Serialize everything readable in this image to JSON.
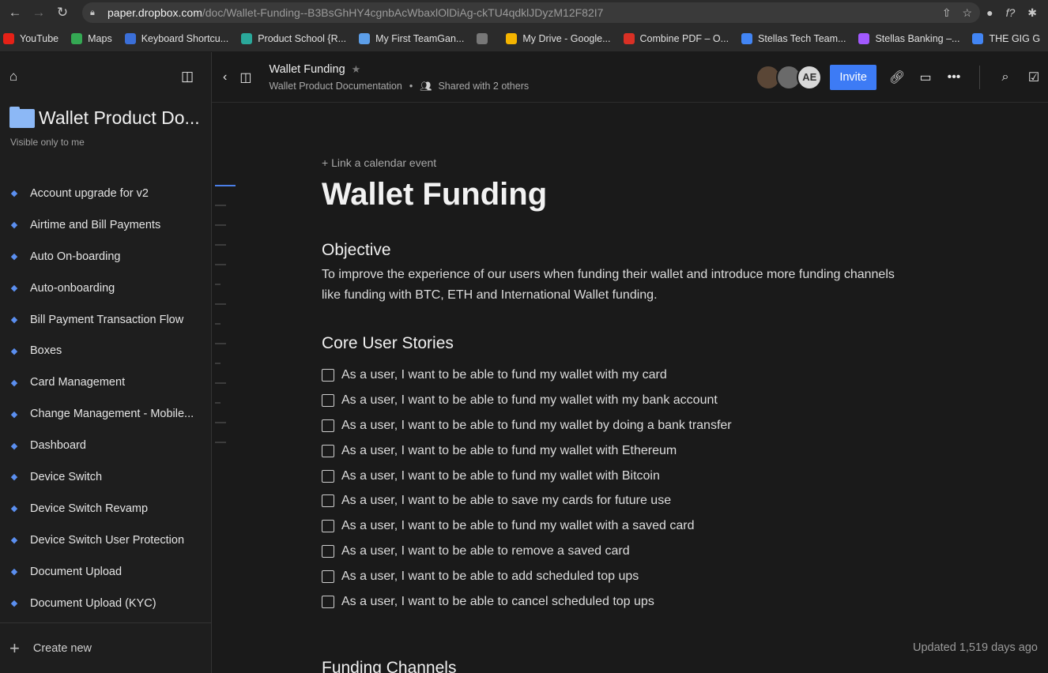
{
  "browser": {
    "url_host": "paper.dropbox.com",
    "url_path": "/doc/Wallet-Funding--B3BsGhHY4cgnbAcWbaxlOlDiAg-ckTU4qdklJDyzM12F82I7"
  },
  "bookmarks": [
    {
      "label": "YouTube",
      "icon": "youtube-icon",
      "color": "#e62117"
    },
    {
      "label": "Maps",
      "icon": "maps-icon",
      "color": "#34a853"
    },
    {
      "label": "Keyboard Shortcu...",
      "icon": "keyboard-icon",
      "color": "#3b6fd8"
    },
    {
      "label": "Product School {R...",
      "icon": "product-school-icon",
      "color": "#2aa89a"
    },
    {
      "label": "My First TeamGan...",
      "icon": "teamgantt-icon",
      "color": "#5c9ee8"
    },
    {
      "label": "",
      "icon": "globe-icon",
      "color": "#777777"
    },
    {
      "label": "My Drive - Google...",
      "icon": "drive-icon",
      "color": "#f4b400"
    },
    {
      "label": "Combine PDF – O...",
      "icon": "pdf-icon",
      "color": "#d93025"
    },
    {
      "label": "Stellas Tech Team...",
      "icon": "docs-icon",
      "color": "#4285f4"
    },
    {
      "label": "Stellas Banking –...",
      "icon": "figma-icon",
      "color": "#a259ff"
    },
    {
      "label": "THE GIG G",
      "icon": "meet-icon",
      "color": "#4285f4"
    }
  ],
  "sidebar": {
    "folder_title": "Wallet Product Do...",
    "visibility": "Visible only to me",
    "items": [
      {
        "label": "Account upgrade for v2"
      },
      {
        "label": "Airtime and Bill Payments"
      },
      {
        "label": "Auto On-boarding"
      },
      {
        "label": "Auto-onboarding"
      },
      {
        "label": "Bill Payment Transaction Flow"
      },
      {
        "label": "Boxes"
      },
      {
        "label": "Card Management"
      },
      {
        "label": "Change Management - Mobile..."
      },
      {
        "label": "Dashboard"
      },
      {
        "label": "Device Switch"
      },
      {
        "label": "Device Switch Revamp"
      },
      {
        "label": "Device Switch User Protection"
      },
      {
        "label": "Document Upload"
      },
      {
        "label": "Document Upload (KYC)"
      }
    ],
    "create_new": "Create new"
  },
  "topbar": {
    "doc_title": "Wallet Funding",
    "breadcrumb": "Wallet Product Documentation",
    "separator": "•",
    "shared": "Shared with 2 others",
    "avatar_initials": "AE",
    "invite_label": "Invite"
  },
  "doc": {
    "link_calendar": "+ Link a calendar event",
    "title": "Wallet Funding",
    "objective_heading": "Objective",
    "objective_text": "To improve the experience of our users when funding their wallet and introduce more funding channels like funding with BTC, ETH and International Wallet funding.",
    "stories_heading": "Core User Stories",
    "stories": [
      "As a user, I want to be able to fund my wallet with my card",
      "As a user, I want to be able to fund my wallet with my bank account",
      "As a user, I want to be able to fund my wallet by doing a bank transfer",
      "As a user, I want to be able to fund my wallet with Ethereum",
      "As a user, I want to be able to fund my wallet with Bitcoin",
      "As a user, I want to be able to save my cards for future use",
      "As a user, I want to be able to fund my wallet with a saved card",
      "As a user, I want to be able to remove a saved card",
      "As a user, I want to be able to add scheduled top ups",
      "As a user, I want to be able to cancel scheduled top ups"
    ],
    "channels_heading": "Funding Channels",
    "updated": "Updated 1,519 days ago"
  },
  "colors": {
    "accent": "#3d7bf5",
    "doc_icon": "#5b8ff0",
    "folder": "#8cb8f6"
  }
}
